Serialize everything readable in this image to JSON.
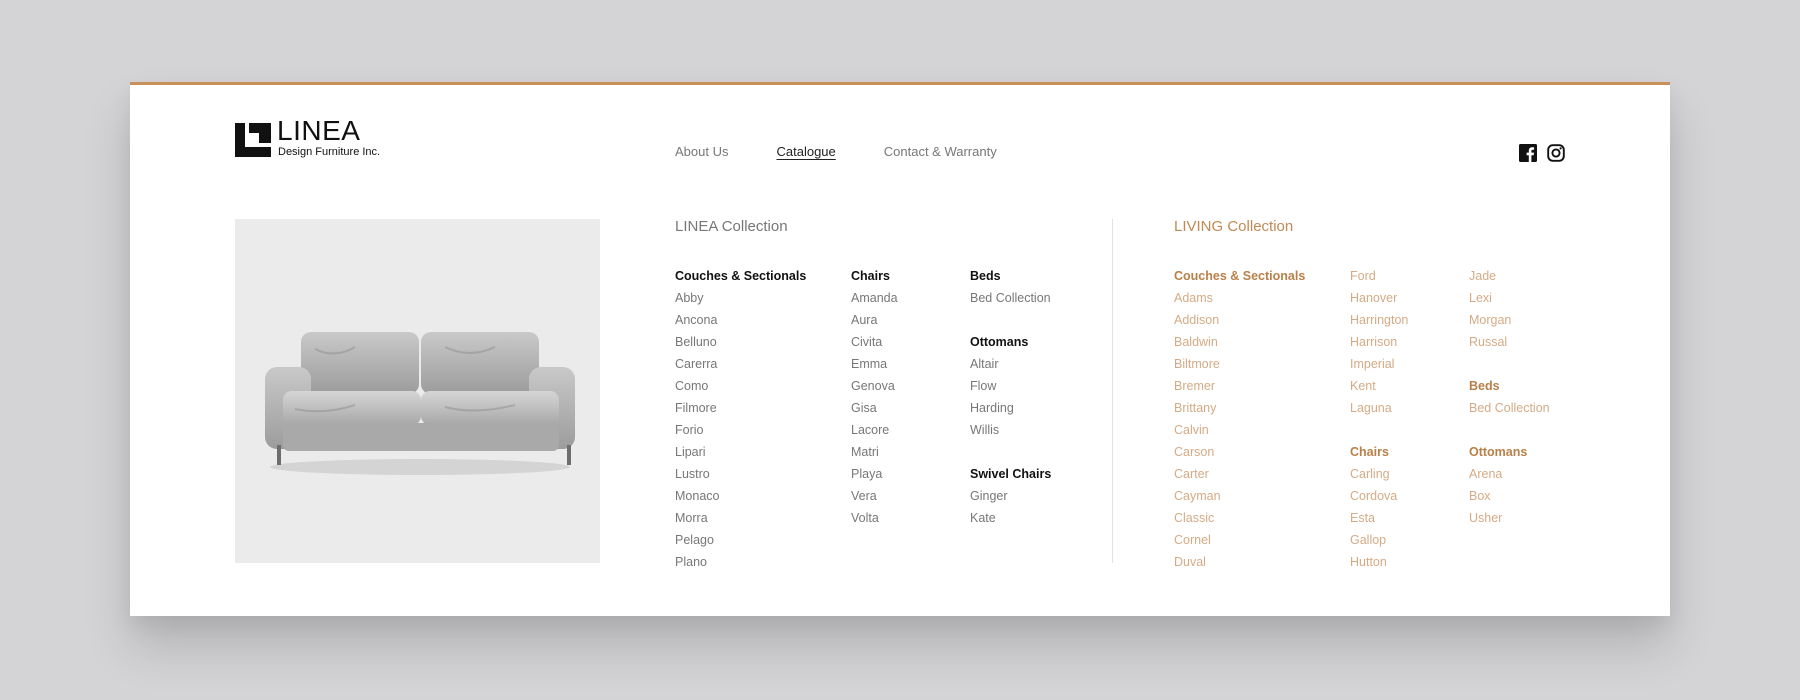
{
  "brand": {
    "name": "LINEA",
    "tagline": "Design Furniture Inc."
  },
  "nav": {
    "items": [
      "About Us",
      "Catalogue",
      "Contact & Warranty"
    ],
    "active": "Catalogue"
  },
  "social": {
    "icons": [
      "facebook-icon",
      "instagram-icon"
    ]
  },
  "colors": {
    "accent": "#c8915a",
    "living_text": "#d4ab85",
    "living_heading": "#b98049",
    "background": "#d4d4d6"
  },
  "hero": {
    "image": "grey-velvet-sofa"
  },
  "linea": {
    "title": "LINEA Collection",
    "couches": {
      "heading": "Couches & Sectionals",
      "items": [
        "Abby",
        "Ancona",
        "Belluno",
        "Carerra",
        "Como",
        "Filmore",
        "Forio",
        "Lipari",
        "Lustro",
        "Monaco",
        "Morra",
        "Pelago",
        "Plano"
      ]
    },
    "chairs": {
      "heading": "Chairs",
      "items": [
        "Amanda",
        "Aura",
        "Civita",
        "Emma",
        "Genova",
        "Gisa",
        "Lacore",
        "Matri",
        "Playa",
        "Vera",
        "Volta"
      ]
    },
    "beds": {
      "heading": "Beds",
      "items": [
        "Bed Collection"
      ]
    },
    "ottomans": {
      "heading": "Ottomans",
      "items": [
        "Altair",
        "Flow",
        "Harding",
        "Willis"
      ]
    },
    "swivel": {
      "heading": "Swivel Chairs",
      "items": [
        "Ginger",
        "Kate"
      ]
    }
  },
  "living": {
    "title": "LIVING Collection",
    "couches": {
      "heading": "Couches & Sectionals",
      "items": [
        "Adams",
        "Addison",
        "Baldwin",
        "Biltmore",
        "Bremer",
        "Brittany",
        "Calvin",
        "Carson",
        "Carter",
        "Cayman",
        "Classic",
        "Cornel",
        "Duval"
      ]
    },
    "couches_cont": {
      "items": [
        "Ford",
        "Hanover",
        "Harrington",
        "Harrison",
        "Imperial",
        "Kent",
        "Laguna"
      ]
    },
    "couches_cont2": {
      "items": [
        "Jade",
        "Lexi",
        "Morgan",
        "Russal"
      ]
    },
    "chairs": {
      "heading": "Chairs",
      "items": [
        "Carling",
        "Cordova",
        "Esta",
        "Gallop",
        "Hutton"
      ]
    },
    "beds": {
      "heading": "Beds",
      "items": [
        "Bed Collection"
      ]
    },
    "ottomans": {
      "heading": "Ottomans",
      "items": [
        "Arena",
        "Box",
        "Usher"
      ]
    }
  }
}
